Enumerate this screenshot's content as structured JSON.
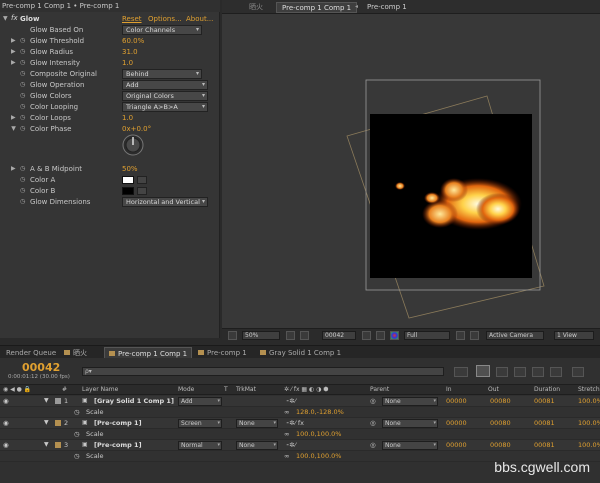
{
  "effect_panel": {
    "title": "Pre-comp 1 Comp 1 • Pre-comp 1",
    "fx_label": "fx",
    "effect_name": "Glow",
    "reset": "Reset",
    "options": "Options...",
    "about": "About...",
    "props": {
      "based_on": {
        "label": "Glow Based On",
        "value": "Color Channels"
      },
      "threshold": {
        "label": "Glow Threshold",
        "value": "60.0%"
      },
      "radius": {
        "label": "Glow Radius",
        "value": "31.0"
      },
      "intensity": {
        "label": "Glow Intensity",
        "value": "1.0"
      },
      "composite": {
        "label": "Composite Original",
        "value": "Behind"
      },
      "operation": {
        "label": "Glow Operation",
        "value": "Add"
      },
      "colors": {
        "label": "Glow Colors",
        "value": "Original Colors"
      },
      "looping": {
        "label": "Color Looping",
        "value": "Triangle A>B>A"
      },
      "loops": {
        "label": "Color Loops",
        "value": "1.0"
      },
      "phase": {
        "label": "Color Phase",
        "value": "0x+0.0°"
      },
      "midpoint": {
        "label": "A & B Midpoint",
        "value": "50%"
      },
      "color_a": {
        "label": "Color A",
        "value": "#ffffff"
      },
      "color_b": {
        "label": "Color B",
        "value": "#000000"
      },
      "dimensions": {
        "label": "Glow Dimensions",
        "value": "Horizontal and Vertical"
      }
    }
  },
  "comp": {
    "tab_lock": "晒火",
    "tabs": [
      "Pre-comp 1 Comp 1",
      "Pre-comp 1"
    ],
    "toolbar": {
      "zoom": "50%",
      "timecode": "00042",
      "resolution": "Full",
      "camera": "Active Camera",
      "views": "1 View"
    }
  },
  "timeline": {
    "tabs": [
      "Render Queue",
      "晒火",
      "Pre-comp 1 Comp 1",
      "Pre-comp 1",
      "Gray Solid 1 Comp 1"
    ],
    "timecode": "00042",
    "timecode_sub": "0:00:01:12 (30.00 fps)",
    "search_placeholder": "ρ▾",
    "columns": {
      "num": "#",
      "layer_name": "Layer Name",
      "mode": "Mode",
      "t": "T",
      "trkmat": "TrkMat",
      "parent": "Parent",
      "in": "In",
      "out": "Out",
      "duration": "Duration",
      "stretch": "Stretch"
    },
    "layers": [
      {
        "num": "1",
        "name": "[Gray Solid 1 Comp 1]",
        "mode": "Add",
        "trkmat": "",
        "parent": "None",
        "in": "00000",
        "out": "00080",
        "duration": "00081",
        "stretch": "100.0%",
        "sub_label": "Scale",
        "sub_value": "128.0,-128.0%"
      },
      {
        "num": "2",
        "name": "[Pre-comp 1]",
        "mode": "Screen",
        "trkmat": "None",
        "parent": "None",
        "in": "00000",
        "out": "00080",
        "duration": "00081",
        "stretch": "100.0%",
        "sub_label": "Scale",
        "sub_value": "100.0,100.0%"
      },
      {
        "num": "3",
        "name": "[Pre-comp 1]",
        "mode": "Normal",
        "trkmat": "None",
        "parent": "None",
        "in": "00000",
        "out": "00080",
        "duration": "00081",
        "stretch": "100.0%",
        "sub_label": "Scale",
        "sub_value": "100.0,100.0%"
      }
    ]
  },
  "watermark": "bbs.cgwell.com"
}
